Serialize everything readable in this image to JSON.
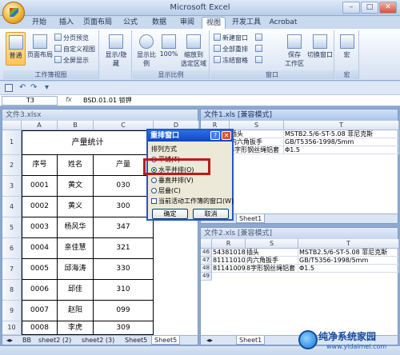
{
  "window": {
    "title": "Microsoft Excel"
  },
  "tabs": [
    "开始",
    "插入",
    "页面布局",
    "公式",
    "数据",
    "审阅",
    "视图",
    "开发工具",
    "Acrobat"
  ],
  "ribbon": {
    "workbook_views": {
      "label": "工作簿视图",
      "normal": "普通",
      "page_layout": "页面布局",
      "page_break": "分页预览",
      "custom_views": "自定义视图",
      "full_screen": "全屏显示"
    },
    "show_hide": {
      "label": "显示/隐藏"
    },
    "zoom": {
      "label": "显示比例",
      "zoom": "显示比例",
      "pct100": "100%",
      "zoom_sel_line1": "缩放到",
      "zoom_sel_line2": "选定区域"
    },
    "window": {
      "label": "窗口",
      "new_window": "新建窗口",
      "arrange_all": "全部重排",
      "freeze": "冻结窗格",
      "save_ws_line1": "保存",
      "save_ws_line2": "工作区",
      "switch_line1": "切换窗口",
      "switch_line2": ""
    },
    "macros": {
      "label": "宏",
      "btn": "宏"
    }
  },
  "formula_bar": {
    "name_box": "T3",
    "fx": "fx",
    "content": "BSD.01.01 锁钾"
  },
  "win1": {
    "title": "文件3.xlsx",
    "cols": [
      "A",
      "B",
      "C",
      "D"
    ],
    "title_cell": "产量统计",
    "headers": [
      "序号",
      "姓名",
      "产量"
    ],
    "rows": [
      {
        "id": "0001",
        "name": "黄文",
        "qty": "030"
      },
      {
        "id": "0002",
        "name": "黄义",
        "qty": "300"
      },
      {
        "id": "0003",
        "name": "杨风华",
        "qty": "347"
      },
      {
        "id": "0004",
        "name": "亲佳慧",
        "qty": "321"
      },
      {
        "id": "0005",
        "name": "邱海涛",
        "qty": "330"
      },
      {
        "id": "0006",
        "name": "邱佳",
        "qty": "310"
      },
      {
        "id": "0007",
        "name": "赵阳",
        "qty": "099"
      },
      {
        "id": "0008",
        "name": "李虎",
        "qty": "309"
      }
    ],
    "row_nums": [
      "1",
      "2",
      "3",
      "4",
      "5",
      "6",
      "7",
      "8",
      "9",
      "10"
    ],
    "sheet_tabs": [
      "BB",
      "sheet2 (2)",
      "sheet2 (3)",
      "Sheet5",
      "Sheet5"
    ]
  },
  "win2": {
    "title": "文件1.xls [兼容模式]",
    "cols": [
      "R",
      "S",
      "T"
    ],
    "rows": [
      {
        "r": "18",
        "s": "插头",
        "t": "MSTB2.5/6-ST-5.08 菲尼克斯"
      },
      {
        "r": "18",
        "s": "内六角扳手",
        "t": "GB/T5356-1998/5mm"
      },
      {
        "r": "090",
        "s": "8字形钢丝绳铝套",
        "t": "Φ1.5"
      }
    ],
    "sheet_tab": "Sheet1"
  },
  "win3": {
    "title": "文件2.xls [兼容模式]",
    "cols": [
      "R",
      "S",
      "T"
    ],
    "row_nums": [
      "46",
      "47",
      "48",
      "49"
    ],
    "rows": [
      {
        "r": "54381018",
        "s": "插头",
        "t": "MSTB2.5/6-ST-5.08 菲尼克斯"
      },
      {
        "r": "811110105",
        "s": "内六角扳手",
        "t": "GB/T5356-1998/5mm"
      },
      {
        "r": "811410090",
        "s": "8字形钢丝绳铝套",
        "t": "Φ1.5"
      }
    ],
    "sheet_tab": "Sheet1"
  },
  "dialog": {
    "title": "重排窗口",
    "section": "排列方式",
    "options": [
      "平铺(T)",
      "水平并排(O)",
      "垂直并排(V)",
      "层叠(C)"
    ],
    "selected": 1,
    "checkbox": "当前活动工作簿的窗口(W)",
    "ok": "确定",
    "cancel": "取消"
  },
  "watermark": {
    "line1": "纯净系统家园",
    "line2": "www.yidaimei.com"
  }
}
